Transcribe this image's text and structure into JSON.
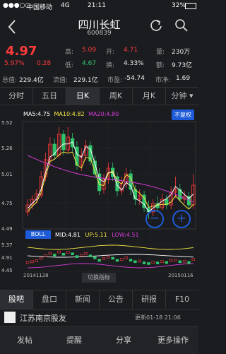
{
  "status_bar": {
    "carrier": "中国移动",
    "network": "4G",
    "time": "21:11",
    "battery": "32%"
  },
  "header": {
    "title": "四川长虹",
    "code": "600839"
  },
  "quote": {
    "price": "4.97",
    "change_pct": "5.97%",
    "change": "0.28",
    "high_label": "高:",
    "high": "5.09",
    "open_label": "开:",
    "open": "4.71",
    "volume_label": "量:",
    "volume": "230万",
    "low_label": "低:",
    "low": "4.67",
    "turnover_rate_label": "换:",
    "turnover_rate": "4.33%",
    "amount_label": "额:",
    "amount": "9.73亿",
    "total_cap_label": "总值:",
    "total_cap": "229.4亿",
    "float_cap_label": "流值:",
    "float_cap": "229.1亿",
    "pe_label": "市盈:",
    "pe": "-54.74",
    "pb_label": "市净:",
    "pb": "1.69"
  },
  "period_tabs": [
    "分时",
    "五日",
    "日K",
    "周K",
    "月K",
    "分钟"
  ],
  "chart": {
    "ma_legend": {
      "ma5": "MA5:4.75",
      "ma10": "MA10:4.82",
      "ma20": "MA20:4.80"
    },
    "adjust_button": "不复权",
    "price_axis": [
      "5.52",
      "5.26",
      "5.01",
      "4.75",
      "4.49"
    ],
    "boll_button": "BOLL",
    "boll_legend": {
      "mid": "MID:4.81",
      "up": "UP:5.11",
      "low": "LOW:4.51"
    },
    "boll_axis": [
      "5.37",
      "4.91",
      "4.45"
    ],
    "date_start": "20141128",
    "date_end": "20150116",
    "switch_button": "切换指标",
    "zoom_out": "−",
    "zoom_in": "+",
    "colors": {
      "up": "#ff3b3b",
      "down": "#31c46c",
      "ma5": "#ffffff",
      "ma10": "#f5e642",
      "ma20": "#d63bd6",
      "accent": "#1e5bd8"
    }
  },
  "bottom_tabs": [
    "股吧",
    "盘口",
    "新闻",
    "公告",
    "研报",
    "F10"
  ],
  "news": {
    "title": "江苏南京股友",
    "time": "更新01-18 21:06"
  },
  "toolbar": [
    "发帖",
    "提醒",
    "分享",
    "更多操作"
  ]
}
